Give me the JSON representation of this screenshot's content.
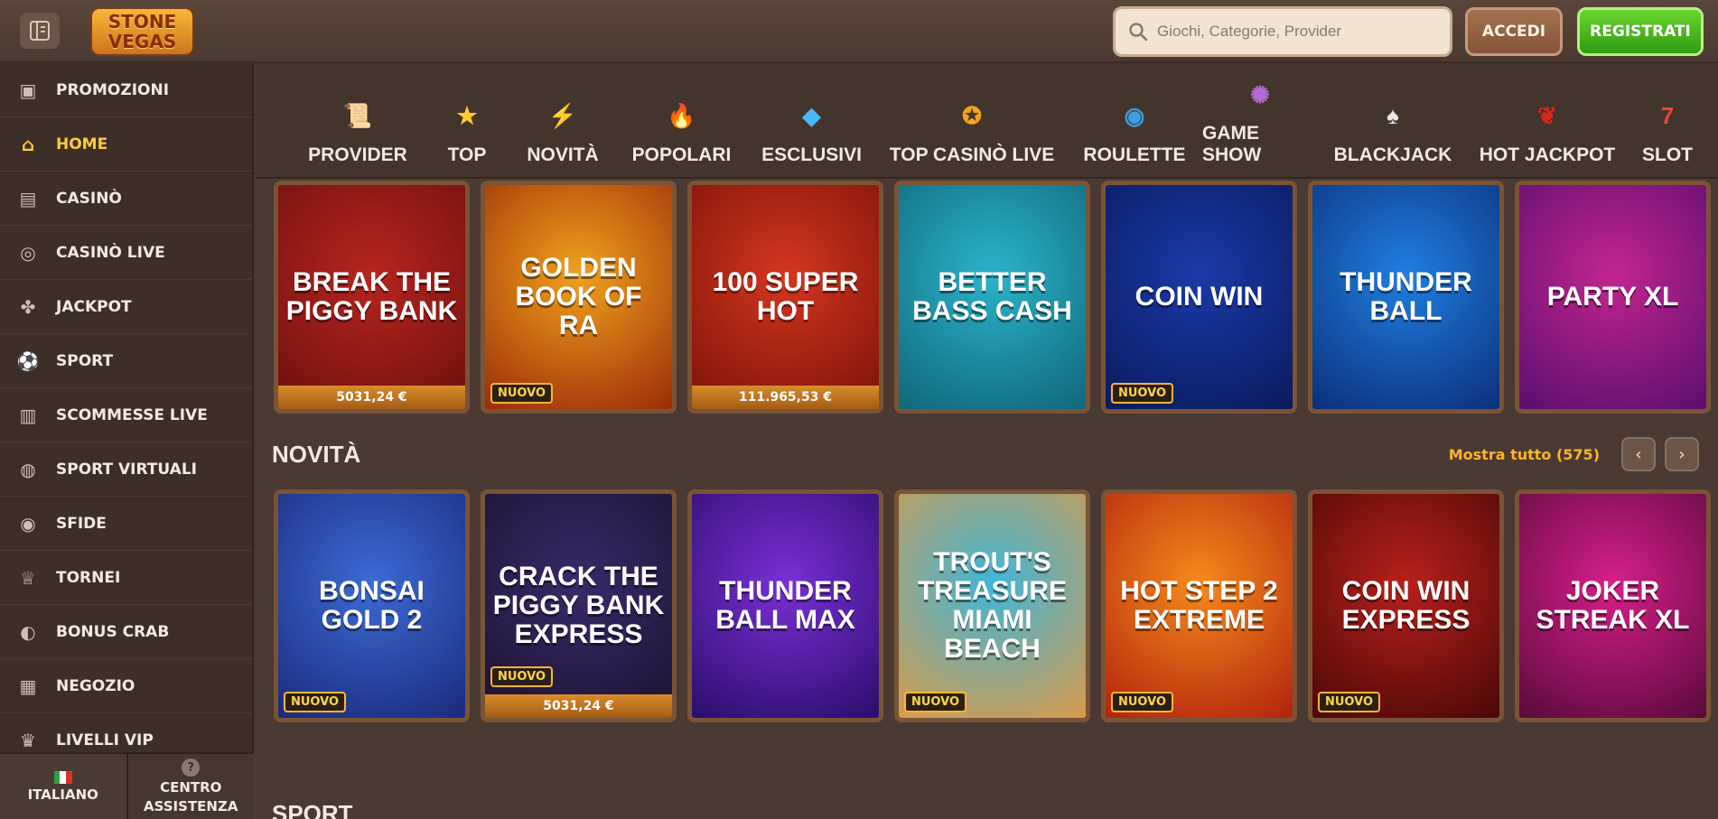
{
  "header": {
    "logo_line1": "STONE",
    "logo_line2": "VEGAS",
    "search_placeholder": "Giochi, Categorie, Provider",
    "login_label": "ACCEDI",
    "register_label": "REGISTRATI"
  },
  "sidebar": {
    "items": [
      {
        "label": "PROMOZIONI",
        "icon": "gift-icon"
      },
      {
        "label": "HOME",
        "icon": "home-icon"
      },
      {
        "label": "CASINÒ",
        "icon": "casino-icon"
      },
      {
        "label": "CASINÒ LIVE",
        "icon": "live-casino-icon"
      },
      {
        "label": "JACKPOT",
        "icon": "jackpot-icon"
      },
      {
        "label": "SPORT",
        "icon": "football-icon"
      },
      {
        "label": "SCOMMESSE LIVE",
        "icon": "live-bet-icon"
      },
      {
        "label": "SPORT VIRTUALI",
        "icon": "virtual-sport-icon"
      },
      {
        "label": "SFIDE",
        "icon": "target-icon"
      },
      {
        "label": "TORNEI",
        "icon": "trophy-icon"
      },
      {
        "label": "BONUS CRAB",
        "icon": "crab-icon"
      },
      {
        "label": "NEGOZIO",
        "icon": "basket-icon"
      },
      {
        "label": "LIVELLI VIP",
        "icon": "crown-icon"
      }
    ],
    "language_label": "ITALIANO",
    "help_label_1": "CENTRO",
    "help_label_2": "ASSISTENZA"
  },
  "categories": [
    {
      "label": "PROVIDER",
      "icon": "scroll-icon",
      "color": "#e8d2a6"
    },
    {
      "label": "TOP",
      "icon": "star-icon",
      "color": "#ffcc2a"
    },
    {
      "label": "NOVITÀ",
      "icon": "lightning-icon",
      "color": "#ffb21c"
    },
    {
      "label": "POPOLARI",
      "icon": "fire-icon",
      "color": "#ff6b1a"
    },
    {
      "label": "ESCLUSIVI",
      "icon": "diamond-icon",
      "color": "#49b8ff"
    },
    {
      "label": "TOP CASINÒ LIVE",
      "icon": "badge-icon",
      "color": "#f2a41b"
    },
    {
      "label": "ROULETTE",
      "icon": "roulette-icon",
      "color": "#3a9fe0"
    },
    {
      "label": "GAME SHOW",
      "icon": "wheel-icon",
      "color": "#b56bd9"
    },
    {
      "label": "BLACKJACK",
      "icon": "cards-icon",
      "color": "#e9e9e9"
    },
    {
      "label": "HOT JACKPOT",
      "icon": "chili-icon",
      "color": "#d9261a"
    },
    {
      "label": "SLOT",
      "icon": "slot-icon",
      "color": "#e8473a"
    }
  ],
  "row1": [
    {
      "title": "BREAK THE PIGGY BANK",
      "jackpot": "5031,24 €",
      "badge": "",
      "c1": "#b8251e",
      "c2": "#6b0f0e"
    },
    {
      "title": "GOLDEN BOOK OF RA",
      "jackpot": "",
      "badge": "NUOVO",
      "c1": "#f0a21c",
      "c2": "#9c2b08"
    },
    {
      "title": "100 SUPER HOT",
      "jackpot": "111.965,53 €",
      "badge": "",
      "c1": "#d43620",
      "c2": "#7a1208"
    },
    {
      "title": "BETTER BASS CASH",
      "jackpot": "",
      "badge": "",
      "c1": "#2ab4c9",
      "c2": "#10667a"
    },
    {
      "title": "COIN WIN",
      "jackpot": "",
      "badge": "NUOVO",
      "c1": "#1a3aa8",
      "c2": "#0a1a5c"
    },
    {
      "title": "THUNDER BALL",
      "jackpot": "",
      "badge": "",
      "c1": "#1f7fe0",
      "c2": "#0c2f7a"
    },
    {
      "title": "PARTY XL",
      "jackpot": "",
      "badge": "",
      "c1": "#c2258f",
      "c2": "#5a0e6e"
    }
  ],
  "section_novita": {
    "title": "NOVITÀ",
    "show_all": "Mostra tutto (575)"
  },
  "row2": [
    {
      "title": "BONSAI GOLD 2",
      "jackpot": "",
      "badge": "NUOVO",
      "c1": "#3c6bd6",
      "c2": "#1a2a7a"
    },
    {
      "title": "CRACK THE PIGGY BANK EXPRESS",
      "jackpot": "5031,24 €",
      "badge": "NUOVO",
      "c1": "#3a2a6a",
      "c2": "#1a1230"
    },
    {
      "title": "THUNDER BALL MAX",
      "jackpot": "",
      "badge": "",
      "c1": "#7a2fd6",
      "c2": "#2a0e6a"
    },
    {
      "title": "TROUT'S TREASURE MIAMI BEACH",
      "jackpot": "",
      "badge": "NUOVO",
      "c1": "#3fb6d9",
      "c2": "#d99a4a"
    },
    {
      "title": "HOT STEP 2 EXTREME",
      "jackpot": "",
      "badge": "NUOVO",
      "c1": "#f58a1a",
      "c2": "#b2220e"
    },
    {
      "title": "COIN WIN EXPRESS",
      "jackpot": "",
      "badge": "NUOVO",
      "c1": "#b8201a",
      "c2": "#4a0808"
    },
    {
      "title": "JOKER STREAK XL",
      "jackpot": "",
      "badge": "",
      "c1": "#d61f8a",
      "c2": "#5a0a3a"
    }
  ],
  "section_sport": {
    "title": "SPORT"
  }
}
